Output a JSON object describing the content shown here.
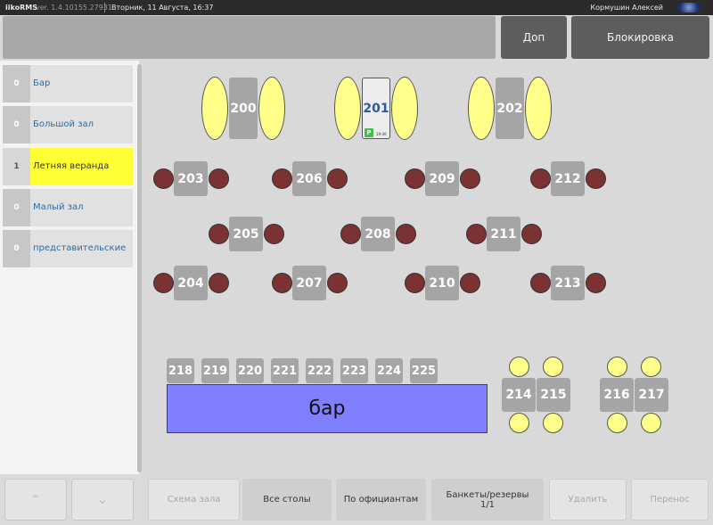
{
  "titlebar": {
    "app": "iikoRMS",
    "version": "ver. 1.4.10155.27931",
    "datetime": "Вторник, 11 Августа, 16:37",
    "user": "Кормушин Алексей"
  },
  "topbar": {
    "dop": "Доп",
    "lock": "Блокировка"
  },
  "halls": [
    {
      "count": "0",
      "name": "Бар"
    },
    {
      "count": "0",
      "name": "Большой зал"
    },
    {
      "count": "1",
      "name": "Летняя веранда",
      "active": true
    },
    {
      "count": "0",
      "name": "Малый зал"
    },
    {
      "count": "0",
      "name": "представительские"
    }
  ],
  "tables": {
    "t200": "200",
    "t201": "201",
    "t202": "202",
    "t203": "203",
    "t206": "206",
    "t209": "209",
    "t212": "212",
    "t205": "205",
    "t208": "208",
    "t211": "211",
    "t204": "204",
    "t207": "207",
    "t210": "210",
    "t213": "213",
    "t218": "218",
    "t219": "219",
    "t220": "220",
    "t221": "221",
    "t222": "222",
    "t223": "223",
    "t224": "224",
    "t225": "225",
    "t214": "214",
    "t215": "215",
    "t216": "216",
    "t217": "217"
  },
  "busy_table": {
    "badge": "P",
    "time": "19:00"
  },
  "bar_label": "бар",
  "colors": {
    "seat_free": "#ffff8a",
    "seat_busy": "#7a3232",
    "active_hall": "#ffff33",
    "bar": "#7f7fff",
    "preorder_badge": "#3fc04a"
  },
  "bottom": {
    "up_icon": "chevron-up-icon",
    "down_icon": "chevron-down-icon",
    "scheme": "Схема зала",
    "all_tables": "Все столы",
    "by_waiters": "По официантам",
    "banquets": "Банкеты/резервы",
    "banquets_page": "1/1",
    "delete": "Удалить",
    "transfer": "Перенос"
  }
}
